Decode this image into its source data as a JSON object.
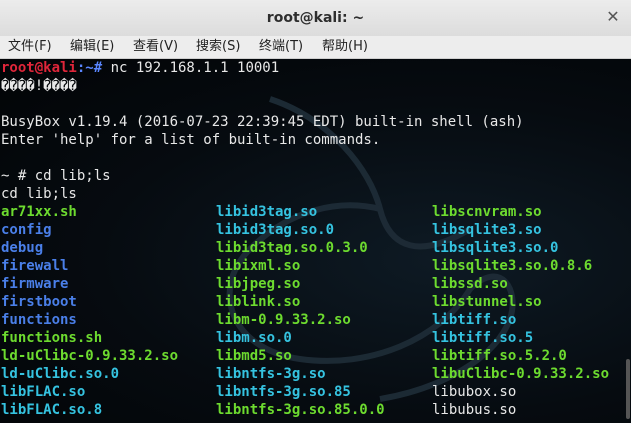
{
  "window": {
    "title": "root@kali: ~",
    "close_glyph": "✕"
  },
  "menu": [
    "文件(F)",
    "编辑(E)",
    "查看(V)",
    "搜索(S)",
    "终端(T)",
    "帮助(H)"
  ],
  "terminal": {
    "prompt_user": "root@kali",
    "prompt_rest": ":~# ",
    "command": "nc 192.168.1.1 10001",
    "garbled": "����!����",
    "busybox": "BusyBox v1.19.4 (2016-07-23 22:39:45 EDT) built-in shell (ash)",
    "help": "Enter 'help' for a list of built-in commands.",
    "prompt2": "~ # cd lib;ls",
    "echo": "cd lib;ls"
  },
  "ls_columns": [
    [
      {
        "name": "ar71xx.sh",
        "c": "green"
      },
      {
        "name": "config",
        "c": "blue"
      },
      {
        "name": "debug",
        "c": "blue"
      },
      {
        "name": "firewall",
        "c": "blue"
      },
      {
        "name": "firmware",
        "c": "blue"
      },
      {
        "name": "firstboot",
        "c": "blue"
      },
      {
        "name": "functions",
        "c": "blue"
      },
      {
        "name": "functions.sh",
        "c": "green"
      },
      {
        "name": "ld-uClibc-0.9.33.2.so",
        "c": "green"
      },
      {
        "name": "ld-uClibc.so.0",
        "c": "cyan"
      },
      {
        "name": "libFLAC.so",
        "c": "cyan"
      },
      {
        "name": "libFLAC.so.8",
        "c": "cyan"
      }
    ],
    [
      {
        "name": "libid3tag.so",
        "c": "cyan"
      },
      {
        "name": "libid3tag.so.0",
        "c": "cyan"
      },
      {
        "name": "libid3tag.so.0.3.0",
        "c": "green"
      },
      {
        "name": "libixml.so",
        "c": "green"
      },
      {
        "name": "libjpeg.so",
        "c": "green"
      },
      {
        "name": "liblink.so",
        "c": "green"
      },
      {
        "name": "libm-0.9.33.2.so",
        "c": "green"
      },
      {
        "name": "libm.so.0",
        "c": "cyan"
      },
      {
        "name": "libmd5.so",
        "c": "green"
      },
      {
        "name": "libntfs-3g.so",
        "c": "cyan"
      },
      {
        "name": "libntfs-3g.so.85",
        "c": "cyan"
      },
      {
        "name": "libntfs-3g.so.85.0.0",
        "c": "green"
      }
    ],
    [
      {
        "name": "libscnvram.so",
        "c": "green"
      },
      {
        "name": "libsqlite3.so",
        "c": "cyan"
      },
      {
        "name": "libsqlite3.so.0",
        "c": "cyan"
      },
      {
        "name": "libsqlite3.so.0.8.6",
        "c": "green"
      },
      {
        "name": "libssd.so",
        "c": "green"
      },
      {
        "name": "libstunnel.so",
        "c": "green"
      },
      {
        "name": "libtiff.so",
        "c": "cyan"
      },
      {
        "name": "libtiff.so.5",
        "c": "cyan"
      },
      {
        "name": "libtiff.so.5.2.0",
        "c": "green"
      },
      {
        "name": "libuClibc-0.9.33.2.so",
        "c": "green"
      },
      {
        "name": "libubox.so",
        "c": "white"
      },
      {
        "name": "libubus.so",
        "c": "white"
      }
    ]
  ],
  "colors": {
    "green": "#6ddb2f",
    "blue": "#4a7fe8",
    "cyan": "#35c3e0",
    "prompt_red": "#e0263a"
  }
}
